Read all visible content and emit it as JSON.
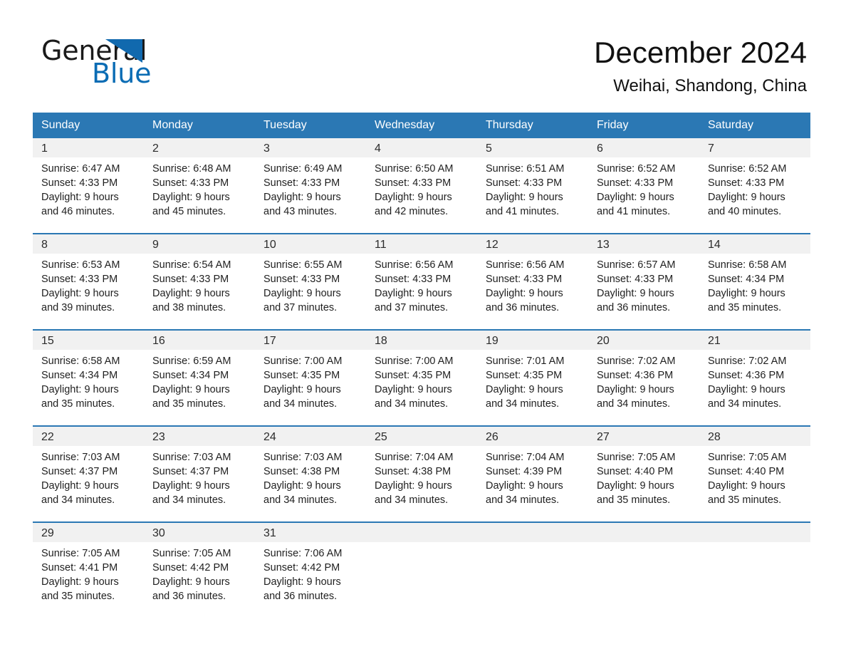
{
  "brand": {
    "name_part1": "General",
    "name_part2": "Blue",
    "triangle_color": "#1169ae",
    "text_color": "#1a1a1a",
    "blue_text_color": "#0a6cb4"
  },
  "header": {
    "title": "December 2024",
    "location": "Weihai, Shandong, China",
    "header_bg": "#2b78b4",
    "separator_color": "#2b78b4",
    "daynum_bg": "#f1f1f1"
  },
  "weekdays": [
    "Sunday",
    "Monday",
    "Tuesday",
    "Wednesday",
    "Thursday",
    "Friday",
    "Saturday"
  ],
  "weeks": [
    [
      {
        "day": "1",
        "sunrise": "Sunrise: 6:47 AM",
        "sunset": "Sunset: 4:33 PM",
        "daylight1": "Daylight: 9 hours",
        "daylight2": "and 46 minutes."
      },
      {
        "day": "2",
        "sunrise": "Sunrise: 6:48 AM",
        "sunset": "Sunset: 4:33 PM",
        "daylight1": "Daylight: 9 hours",
        "daylight2": "and 45 minutes."
      },
      {
        "day": "3",
        "sunrise": "Sunrise: 6:49 AM",
        "sunset": "Sunset: 4:33 PM",
        "daylight1": "Daylight: 9 hours",
        "daylight2": "and 43 minutes."
      },
      {
        "day": "4",
        "sunrise": "Sunrise: 6:50 AM",
        "sunset": "Sunset: 4:33 PM",
        "daylight1": "Daylight: 9 hours",
        "daylight2": "and 42 minutes."
      },
      {
        "day": "5",
        "sunrise": "Sunrise: 6:51 AM",
        "sunset": "Sunset: 4:33 PM",
        "daylight1": "Daylight: 9 hours",
        "daylight2": "and 41 minutes."
      },
      {
        "day": "6",
        "sunrise": "Sunrise: 6:52 AM",
        "sunset": "Sunset: 4:33 PM",
        "daylight1": "Daylight: 9 hours",
        "daylight2": "and 41 minutes."
      },
      {
        "day": "7",
        "sunrise": "Sunrise: 6:52 AM",
        "sunset": "Sunset: 4:33 PM",
        "daylight1": "Daylight: 9 hours",
        "daylight2": "and 40 minutes."
      }
    ],
    [
      {
        "day": "8",
        "sunrise": "Sunrise: 6:53 AM",
        "sunset": "Sunset: 4:33 PM",
        "daylight1": "Daylight: 9 hours",
        "daylight2": "and 39 minutes."
      },
      {
        "day": "9",
        "sunrise": "Sunrise: 6:54 AM",
        "sunset": "Sunset: 4:33 PM",
        "daylight1": "Daylight: 9 hours",
        "daylight2": "and 38 minutes."
      },
      {
        "day": "10",
        "sunrise": "Sunrise: 6:55 AM",
        "sunset": "Sunset: 4:33 PM",
        "daylight1": "Daylight: 9 hours",
        "daylight2": "and 37 minutes."
      },
      {
        "day": "11",
        "sunrise": "Sunrise: 6:56 AM",
        "sunset": "Sunset: 4:33 PM",
        "daylight1": "Daylight: 9 hours",
        "daylight2": "and 37 minutes."
      },
      {
        "day": "12",
        "sunrise": "Sunrise: 6:56 AM",
        "sunset": "Sunset: 4:33 PM",
        "daylight1": "Daylight: 9 hours",
        "daylight2": "and 36 minutes."
      },
      {
        "day": "13",
        "sunrise": "Sunrise: 6:57 AM",
        "sunset": "Sunset: 4:33 PM",
        "daylight1": "Daylight: 9 hours",
        "daylight2": "and 36 minutes."
      },
      {
        "day": "14",
        "sunrise": "Sunrise: 6:58 AM",
        "sunset": "Sunset: 4:34 PM",
        "daylight1": "Daylight: 9 hours",
        "daylight2": "and 35 minutes."
      }
    ],
    [
      {
        "day": "15",
        "sunrise": "Sunrise: 6:58 AM",
        "sunset": "Sunset: 4:34 PM",
        "daylight1": "Daylight: 9 hours",
        "daylight2": "and 35 minutes."
      },
      {
        "day": "16",
        "sunrise": "Sunrise: 6:59 AM",
        "sunset": "Sunset: 4:34 PM",
        "daylight1": "Daylight: 9 hours",
        "daylight2": "and 35 minutes."
      },
      {
        "day": "17",
        "sunrise": "Sunrise: 7:00 AM",
        "sunset": "Sunset: 4:35 PM",
        "daylight1": "Daylight: 9 hours",
        "daylight2": "and 34 minutes."
      },
      {
        "day": "18",
        "sunrise": "Sunrise: 7:00 AM",
        "sunset": "Sunset: 4:35 PM",
        "daylight1": "Daylight: 9 hours",
        "daylight2": "and 34 minutes."
      },
      {
        "day": "19",
        "sunrise": "Sunrise: 7:01 AM",
        "sunset": "Sunset: 4:35 PM",
        "daylight1": "Daylight: 9 hours",
        "daylight2": "and 34 minutes."
      },
      {
        "day": "20",
        "sunrise": "Sunrise: 7:02 AM",
        "sunset": "Sunset: 4:36 PM",
        "daylight1": "Daylight: 9 hours",
        "daylight2": "and 34 minutes."
      },
      {
        "day": "21",
        "sunrise": "Sunrise: 7:02 AM",
        "sunset": "Sunset: 4:36 PM",
        "daylight1": "Daylight: 9 hours",
        "daylight2": "and 34 minutes."
      }
    ],
    [
      {
        "day": "22",
        "sunrise": "Sunrise: 7:03 AM",
        "sunset": "Sunset: 4:37 PM",
        "daylight1": "Daylight: 9 hours",
        "daylight2": "and 34 minutes."
      },
      {
        "day": "23",
        "sunrise": "Sunrise: 7:03 AM",
        "sunset": "Sunset: 4:37 PM",
        "daylight1": "Daylight: 9 hours",
        "daylight2": "and 34 minutes."
      },
      {
        "day": "24",
        "sunrise": "Sunrise: 7:03 AM",
        "sunset": "Sunset: 4:38 PM",
        "daylight1": "Daylight: 9 hours",
        "daylight2": "and 34 minutes."
      },
      {
        "day": "25",
        "sunrise": "Sunrise: 7:04 AM",
        "sunset": "Sunset: 4:38 PM",
        "daylight1": "Daylight: 9 hours",
        "daylight2": "and 34 minutes."
      },
      {
        "day": "26",
        "sunrise": "Sunrise: 7:04 AM",
        "sunset": "Sunset: 4:39 PM",
        "daylight1": "Daylight: 9 hours",
        "daylight2": "and 34 minutes."
      },
      {
        "day": "27",
        "sunrise": "Sunrise: 7:05 AM",
        "sunset": "Sunset: 4:40 PM",
        "daylight1": "Daylight: 9 hours",
        "daylight2": "and 35 minutes."
      },
      {
        "day": "28",
        "sunrise": "Sunrise: 7:05 AM",
        "sunset": "Sunset: 4:40 PM",
        "daylight1": "Daylight: 9 hours",
        "daylight2": "and 35 minutes."
      }
    ],
    [
      {
        "day": "29",
        "sunrise": "Sunrise: 7:05 AM",
        "sunset": "Sunset: 4:41 PM",
        "daylight1": "Daylight: 9 hours",
        "daylight2": "and 35 minutes."
      },
      {
        "day": "30",
        "sunrise": "Sunrise: 7:05 AM",
        "sunset": "Sunset: 4:42 PM",
        "daylight1": "Daylight: 9 hours",
        "daylight2": "and 36 minutes."
      },
      {
        "day": "31",
        "sunrise": "Sunrise: 7:06 AM",
        "sunset": "Sunset: 4:42 PM",
        "daylight1": "Daylight: 9 hours",
        "daylight2": "and 36 minutes."
      },
      {
        "day": "",
        "sunrise": "",
        "sunset": "",
        "daylight1": "",
        "daylight2": ""
      },
      {
        "day": "",
        "sunrise": "",
        "sunset": "",
        "daylight1": "",
        "daylight2": ""
      },
      {
        "day": "",
        "sunrise": "",
        "sunset": "",
        "daylight1": "",
        "daylight2": ""
      },
      {
        "day": "",
        "sunrise": "",
        "sunset": "",
        "daylight1": "",
        "daylight2": ""
      }
    ]
  ]
}
